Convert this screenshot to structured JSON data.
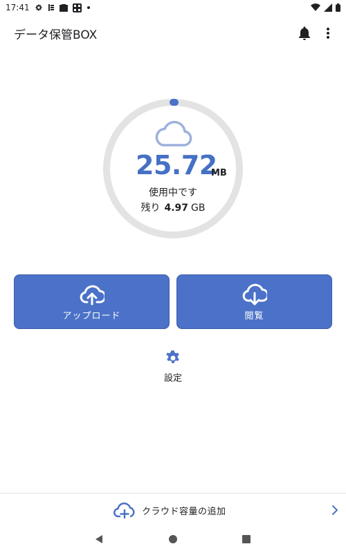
{
  "status_bar": {
    "time": "17:41",
    "icons": [
      "gear-icon",
      "notification-icon",
      "mail-icon",
      "qr-icon",
      "dot-icon",
      "wifi-icon",
      "signal-icon",
      "battery-icon"
    ]
  },
  "app_bar": {
    "title": "データ保管BOX",
    "icons": [
      "bell-icon",
      "more-vert-icon"
    ]
  },
  "usage": {
    "value": "25.72",
    "unit": "MB",
    "in_use_label": "使用中です",
    "remaining_label": "残り",
    "remaining_value": "4.97",
    "remaining_unit": "GB",
    "gauge_fraction": 0.005,
    "icon": "cloud-icon"
  },
  "actions": {
    "upload_label": "アップロード",
    "upload_icon": "cloud-upload-icon",
    "browse_label": "閲覧",
    "browse_icon": "cloud-download-icon"
  },
  "settings": {
    "label": "設定",
    "icon": "gear-icon"
  },
  "bottom_bar": {
    "label": "クラウド容量の追加",
    "icon": "cloud-add-icon",
    "chevron_icon": "chevron-right-icon"
  },
  "colors": {
    "accent": "#4b72c8",
    "value_text": "#4670c4",
    "gauge_track": "#e3e3e3",
    "cloud_outline": "#9db1dc"
  }
}
